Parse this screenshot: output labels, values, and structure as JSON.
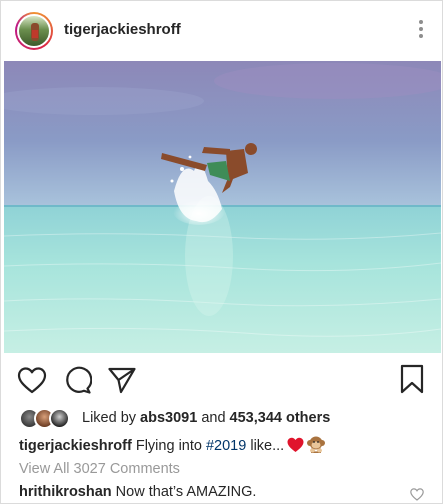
{
  "post": {
    "username": "tigerjackieshroff",
    "photo": {
      "description_icon": "photo-icon",
      "colors": {
        "sky": "#7e8bb7",
        "sea": "#9fe0d8",
        "splash": "#ffffff"
      }
    },
    "likes": {
      "prefix": "Liked by ",
      "first_user": "abs3091",
      "joiner": " and ",
      "others": "453,344 others"
    },
    "caption": {
      "username": "tigerjackieshroff",
      "text_before": " Flying into ",
      "hashtag": "#2019",
      "text_after": " like...",
      "emojis": [
        "heart-emoji",
        "monkey-emoji"
      ]
    },
    "view_all_comments": "View All 3027 Comments",
    "comment": {
      "username": "hrithikroshan",
      "text": " Now that’s AMAZING."
    }
  },
  "colors": {
    "text": "#262626",
    "muted": "#999999",
    "hashtag": "#003569",
    "heart_red": "#e0142c"
  },
  "icons": [
    "more-options-icon",
    "like-icon",
    "comment-icon",
    "share-icon",
    "bookmark-icon",
    "comment-like-icon"
  ]
}
